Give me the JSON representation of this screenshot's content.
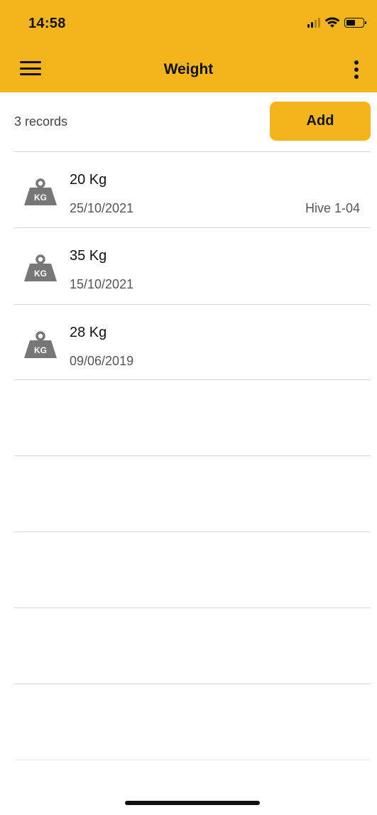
{
  "status_bar": {
    "time": "14:58",
    "icons": [
      "signal-icon",
      "wifi-icon",
      "battery-icon"
    ]
  },
  "header": {
    "title": "Weight",
    "menu_icon": "hamburger-menu-icon",
    "more_icon": "more-vertical-icon",
    "background_color": "#f3b51b"
  },
  "toolbar": {
    "records_count": "3 records",
    "add_label": "Add"
  },
  "records": [
    {
      "weight": "20 Kg",
      "date": "25/10/2021",
      "hive": "Hive 1-04",
      "icon": "weight-kg-icon"
    },
    {
      "weight": "35 Kg",
      "date": "15/10/2021",
      "hive": "",
      "icon": "weight-kg-icon"
    },
    {
      "weight": "28 Kg",
      "date": "09/06/2019",
      "hive": "",
      "icon": "weight-kg-icon"
    }
  ],
  "colors": {
    "accent": "#f3b51b",
    "icon_gray": "#777777",
    "divider": "#d6d6d6"
  }
}
